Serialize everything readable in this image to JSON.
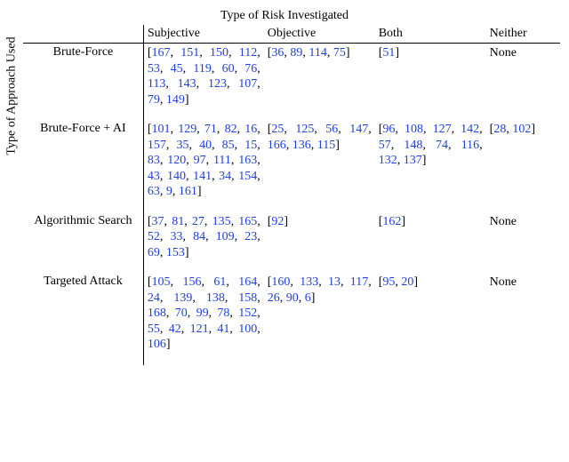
{
  "titles": {
    "top": "Type of Risk Investigated",
    "left": "Type of Approach Used"
  },
  "columns": [
    "Subjective",
    "Objective",
    "Both",
    "Neither"
  ],
  "rows": [
    {
      "label": "Brute-Force",
      "subjective": [
        "167",
        "151",
        "150",
        "112",
        "53",
        "45",
        "119",
        "60",
        "76",
        "113",
        "143",
        "123",
        "107",
        "79",
        "149"
      ],
      "objective": [
        "36",
        "89",
        "114",
        "75"
      ],
      "both": [
        "51"
      ],
      "neither": "None"
    },
    {
      "label": "Brute-Force + AI",
      "subjective": [
        "101",
        "129",
        "71",
        "82",
        "16",
        "157",
        "35",
        "40",
        "85",
        "15",
        "83",
        "120",
        "97",
        "111",
        "163",
        "43",
        "140",
        "141",
        "34",
        "154",
        "63",
        "9",
        "161"
      ],
      "objective": [
        "25",
        "125",
        "56",
        "147",
        "166",
        "136",
        "115"
      ],
      "both": [
        "96",
        "108",
        "127",
        "142",
        "57",
        "148",
        "74",
        "116",
        "132",
        "137"
      ],
      "neither": [
        "28",
        "102"
      ]
    },
    {
      "label": "Algorithmic Search",
      "subjective": [
        "37",
        "81",
        "27",
        "135",
        "165",
        "52",
        "33",
        "84",
        "109",
        "23",
        "69",
        "153"
      ],
      "objective": [
        "92"
      ],
      "both": [
        "162"
      ],
      "neither": "None"
    },
    {
      "label": "Targeted Attack",
      "subjective": [
        "105",
        "156",
        "61",
        "164",
        "24",
        "139",
        "138",
        "158",
        "168",
        "70",
        "99",
        "78",
        "152",
        "55",
        "42",
        "121",
        "41",
        "100",
        "106"
      ],
      "objective": [
        "160",
        "133",
        "13",
        "117",
        "26",
        "90",
        "6"
      ],
      "both": [
        "95",
        "20"
      ],
      "neither": "None"
    }
  ]
}
